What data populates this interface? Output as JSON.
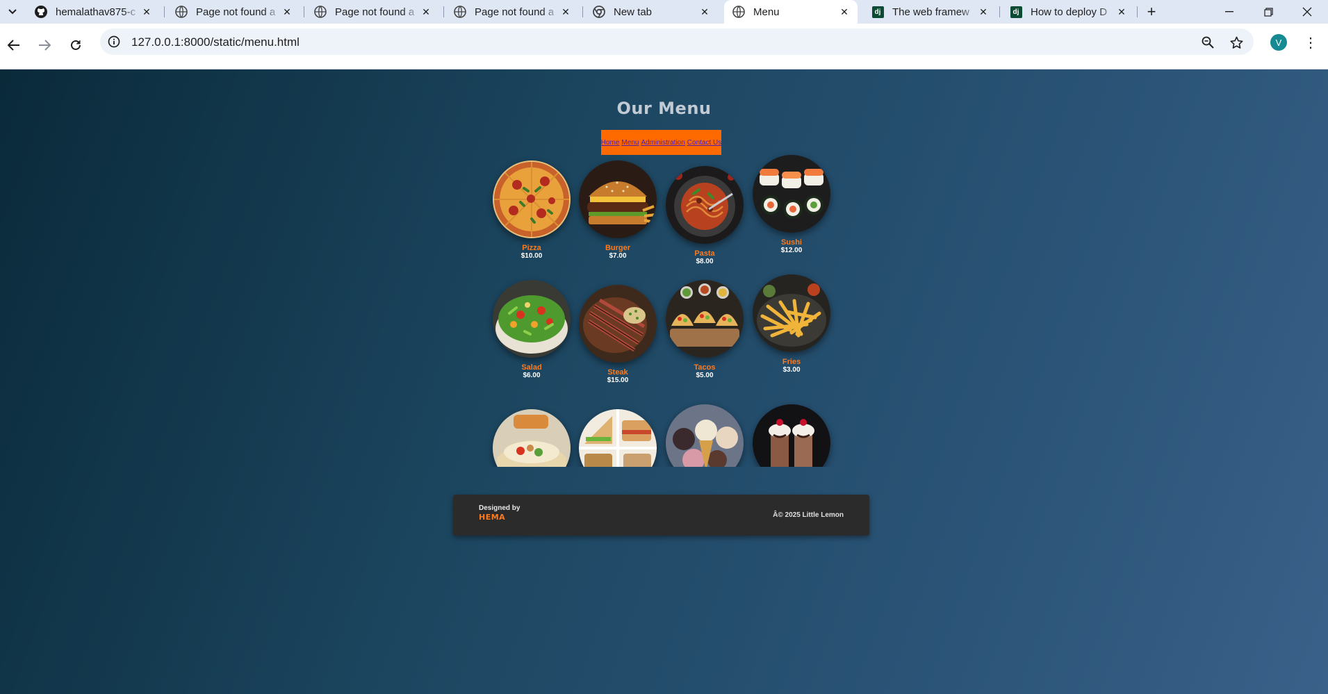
{
  "browser": {
    "tabs": [
      {
        "title": "hemalathav875-c",
        "favicon": "github-icon"
      },
      {
        "title": "Page not found a",
        "favicon": "globe-icon"
      },
      {
        "title": "Page not found a",
        "favicon": "globe-icon"
      },
      {
        "title": "Page not found a",
        "favicon": "globe-icon"
      },
      {
        "title": "New tab",
        "favicon": "chrome-icon"
      },
      {
        "title": "Menu",
        "favicon": "globe-icon",
        "active": true
      },
      {
        "title": "The web framew",
        "favicon": "django-icon"
      },
      {
        "title": "How to deploy D",
        "favicon": "django-icon"
      }
    ],
    "django_badge": "dj",
    "url": "127.0.0.1:8000/static/menu.html",
    "profile_initial": "V"
  },
  "page": {
    "title": "Our Menu",
    "nav": [
      "Home",
      "Menu",
      "Administration",
      "Contact Us"
    ],
    "items": [
      {
        "name": "Pizza",
        "price": "$10.00"
      },
      {
        "name": "Burger",
        "price": "$7.00"
      },
      {
        "name": "Pasta",
        "price": "$8.00"
      },
      {
        "name": "Sushi",
        "price": "$12.00"
      },
      {
        "name": "Salad",
        "price": "$6.00"
      },
      {
        "name": "Steak",
        "price": "$15.00"
      },
      {
        "name": "Tacos",
        "price": "$5.00"
      },
      {
        "name": "Fries",
        "price": "$3.00"
      }
    ],
    "footer": {
      "designed_by": "Designed by",
      "designer": "HEMA",
      "copyright": "Â© 2025 Little Lemon"
    }
  },
  "colors": {
    "accent": "#ff6a00",
    "item_name": "#ff7a1a",
    "footer_bg": "#2b2b2b",
    "bg_start": "#0a2a3a",
    "bg_end": "#3a6189"
  }
}
